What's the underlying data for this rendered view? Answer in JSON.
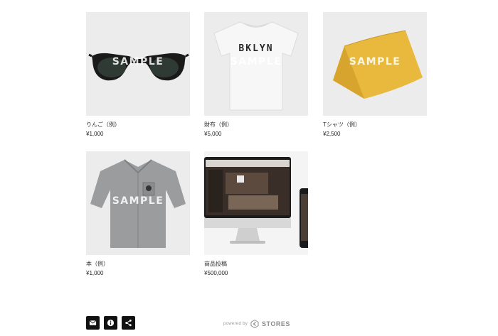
{
  "products": [
    {
      "name": "りんご（例）",
      "price": "¥1,000",
      "watermark": "SAMPLE",
      "image": "sunglasses"
    },
    {
      "name": "財布（例）",
      "price": "¥5,000",
      "watermark": "SAMPLE",
      "image": "tshirt",
      "print_text": "BKLYN"
    },
    {
      "name": "Tシャツ（例）",
      "price": "¥2,500",
      "watermark": "SAMPLE",
      "image": "yellow-pouch"
    },
    {
      "name": "本（例）",
      "price": "¥1,000",
      "watermark": "SAMPLE",
      "image": "shirt"
    },
    {
      "name": "商品投稿",
      "price": "¥500,000",
      "image": "monitor-and-phone"
    }
  ],
  "footer": {
    "icons": [
      "mail-icon",
      "info-icon",
      "share-icon"
    ],
    "powered_by": "powered by",
    "brand": "STORES"
  },
  "colors": {
    "thumb_bg": "#ececec",
    "icon_bg": "#111111",
    "pouch": "#e8b93c"
  }
}
